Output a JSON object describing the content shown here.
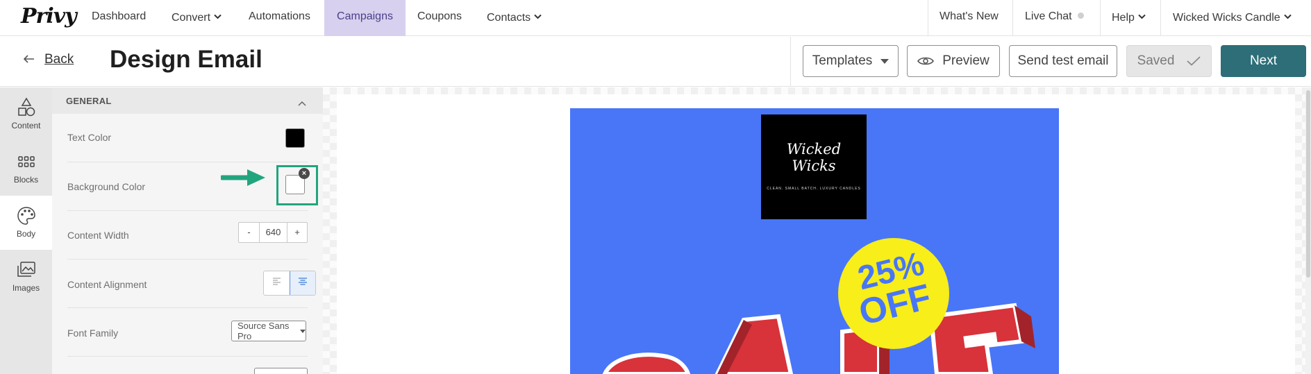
{
  "brand": {
    "logo_text": "Privy"
  },
  "nav": {
    "dashboard": "Dashboard",
    "convert": "Convert",
    "automations": "Automations",
    "campaigns": "Campaigns",
    "coupons": "Coupons",
    "contacts": "Contacts",
    "whats_new": "What's New",
    "live_chat": "Live Chat",
    "help": "Help",
    "account": "Wicked Wicks Candle"
  },
  "header": {
    "back": "Back",
    "title": "Design Email",
    "templates": "Templates",
    "preview": "Preview",
    "send_test": "Send test email",
    "saved": "Saved",
    "next": "Next"
  },
  "rail": {
    "content": "Content",
    "blocks": "Blocks",
    "body": "Body",
    "images": "Images"
  },
  "panel": {
    "section": "GENERAL",
    "text_color_label": "Text Color",
    "background_color_label": "Background Color",
    "content_width_label": "Content Width",
    "content_width_value": "640",
    "minus": "-",
    "plus": "+",
    "content_alignment_label": "Content Alignment",
    "content_alignment_value": "center",
    "font_family_label": "Font Family",
    "font_family_value": "Source Sans Pro"
  },
  "email": {
    "logo_line1": "Wicked",
    "logo_line2": "Wicks",
    "logo_tagline": "CLEAN. SMALL BATCH. LUXURY CANDLES",
    "badge_line1": "25%",
    "badge_line2": "OFF",
    "sale_word": "SALE"
  },
  "colors": {
    "active_nav_bg": "#d7d0ee",
    "next_button": "#2d6e78",
    "highlight": "#21a57f",
    "email_bg": "#4876f7",
    "badge": "#f7ee1a",
    "sale_red": "#d8323a",
    "text_color_swatch": "#000000",
    "background_color_swatch": "#ffffff"
  }
}
